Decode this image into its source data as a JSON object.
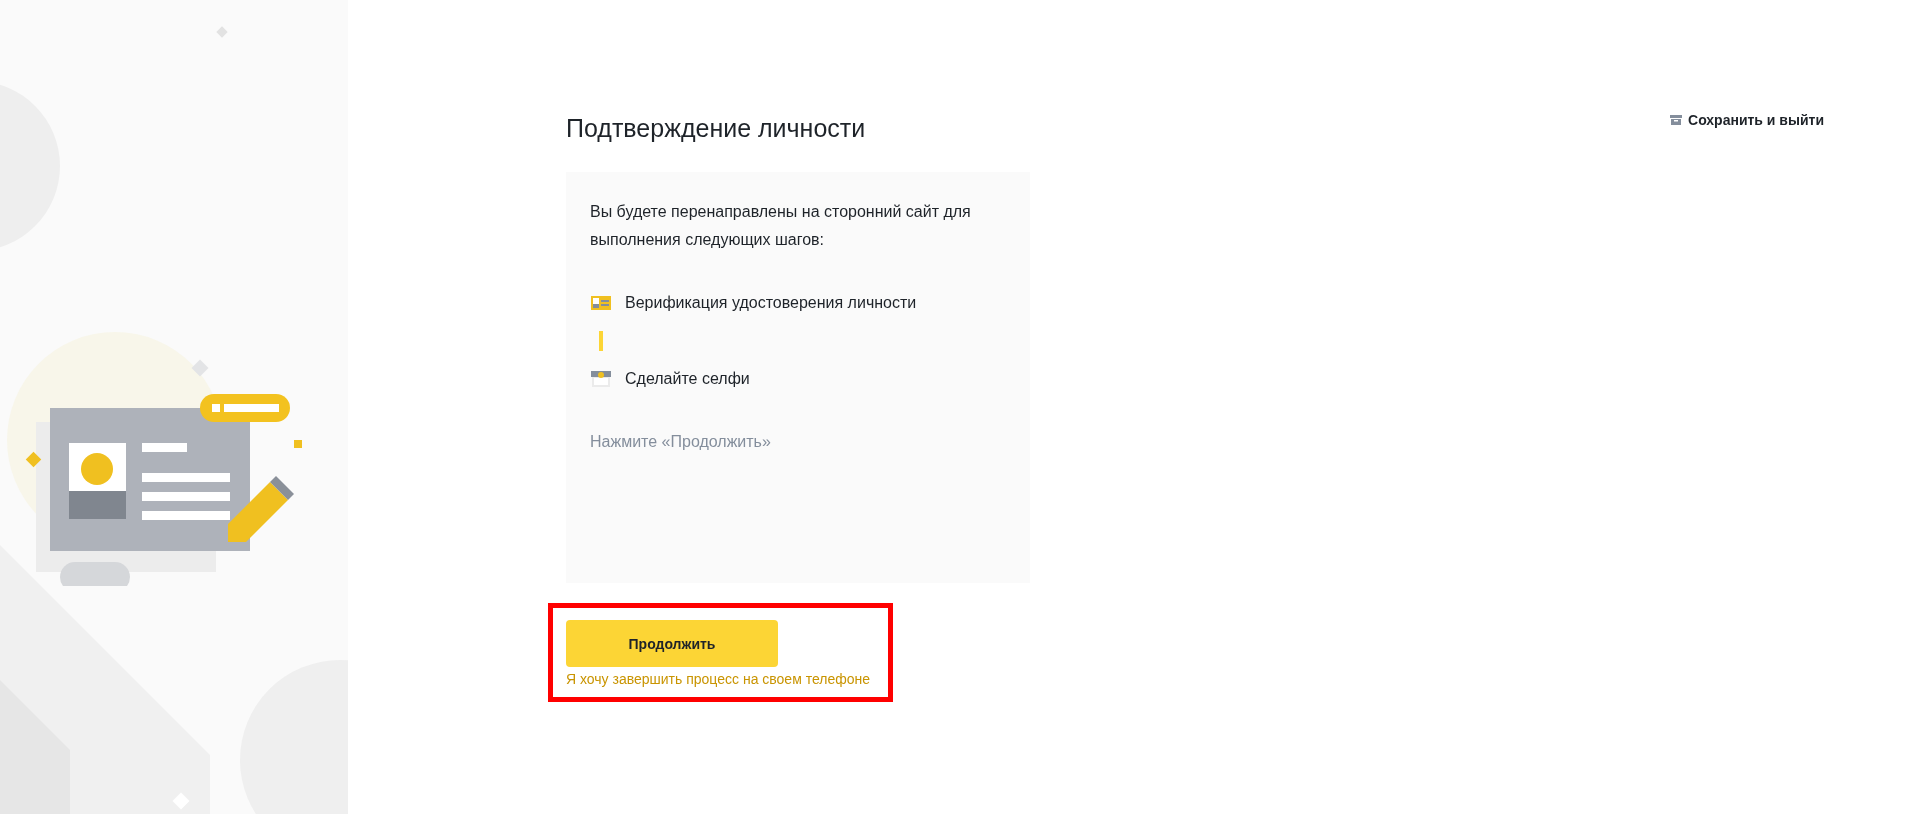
{
  "title": "Подтверждение личности",
  "save_link": {
    "label": "Сохранить и выйти"
  },
  "card": {
    "intro": "Вы будете перенаправлены на сторонний сайт для выполнения следующих шагов:",
    "steps": [
      {
        "kind": "id",
        "label": "Верификация удостоверения личности"
      },
      {
        "kind": "selfie",
        "label": "Сделайте селфи"
      }
    ],
    "hint": "Нажмите «Продолжить»"
  },
  "continue_button": {
    "label": "Продолжить"
  },
  "phone_link": {
    "label": "Я хочу завершить процесс на своем телефоне"
  },
  "highlighted": true
}
